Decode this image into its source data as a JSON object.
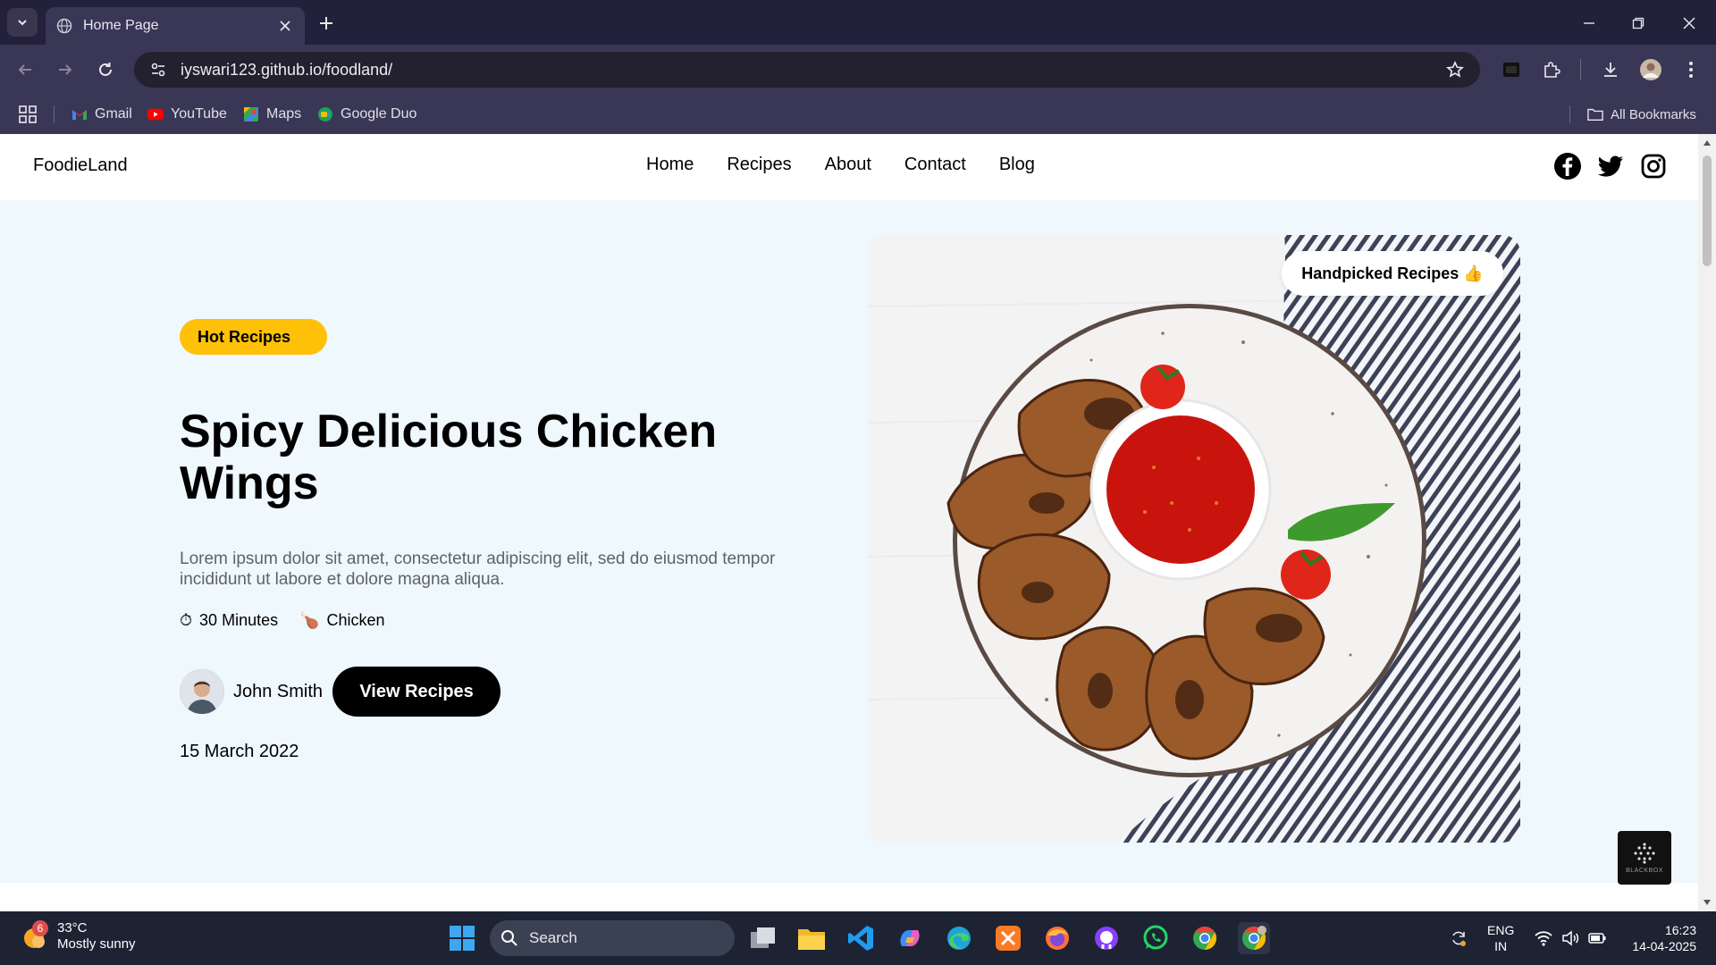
{
  "browser": {
    "tab_title": "Home Page",
    "url": "iyswari123.github.io/foodland/",
    "bookmarks": [
      {
        "label": "Gmail",
        "icon": "gmail-icon"
      },
      {
        "label": "YouTube",
        "icon": "youtube-icon"
      },
      {
        "label": "Maps",
        "icon": "maps-icon"
      },
      {
        "label": "Google Duo",
        "icon": "google-duo-icon"
      }
    ],
    "all_bookmarks": "All Bookmarks"
  },
  "site": {
    "logo": "FoodieLand",
    "nav": [
      "Home",
      "Recipes",
      "About",
      "Contact",
      "Blog"
    ],
    "social": [
      "facebook-icon",
      "twitter-icon",
      "instagram-icon"
    ]
  },
  "hero": {
    "badge": "Hot Recipes",
    "title": "Spicy Delicious Chicken Wings",
    "description": "Lorem ipsum dolor sit amet, consectetur adipiscing elit, sed do eiusmod tempor incididunt ut labore et dolore magna aliqua.",
    "time_icon": "⏱",
    "time": "30 Minutes",
    "category_icon": "🍗",
    "category": "Chicken",
    "author": "John Smith",
    "button": "View Recipes",
    "date": "15 March 2022",
    "image_badge": "Handpicked Recipes 👍"
  },
  "widget": {
    "label": "BLACKBOX"
  },
  "taskbar": {
    "weather_temp": "33°C",
    "weather_desc": "Mostly sunny",
    "weather_badge": "6",
    "search_placeholder": "Search",
    "lang_top": "ENG",
    "lang_bottom": "IN",
    "time": "16:23",
    "date": "14-04-2025"
  },
  "colors": {
    "accent": "#ffc107",
    "hero_bg": "#eef8fd",
    "chrome_bg": "#3a3656"
  }
}
